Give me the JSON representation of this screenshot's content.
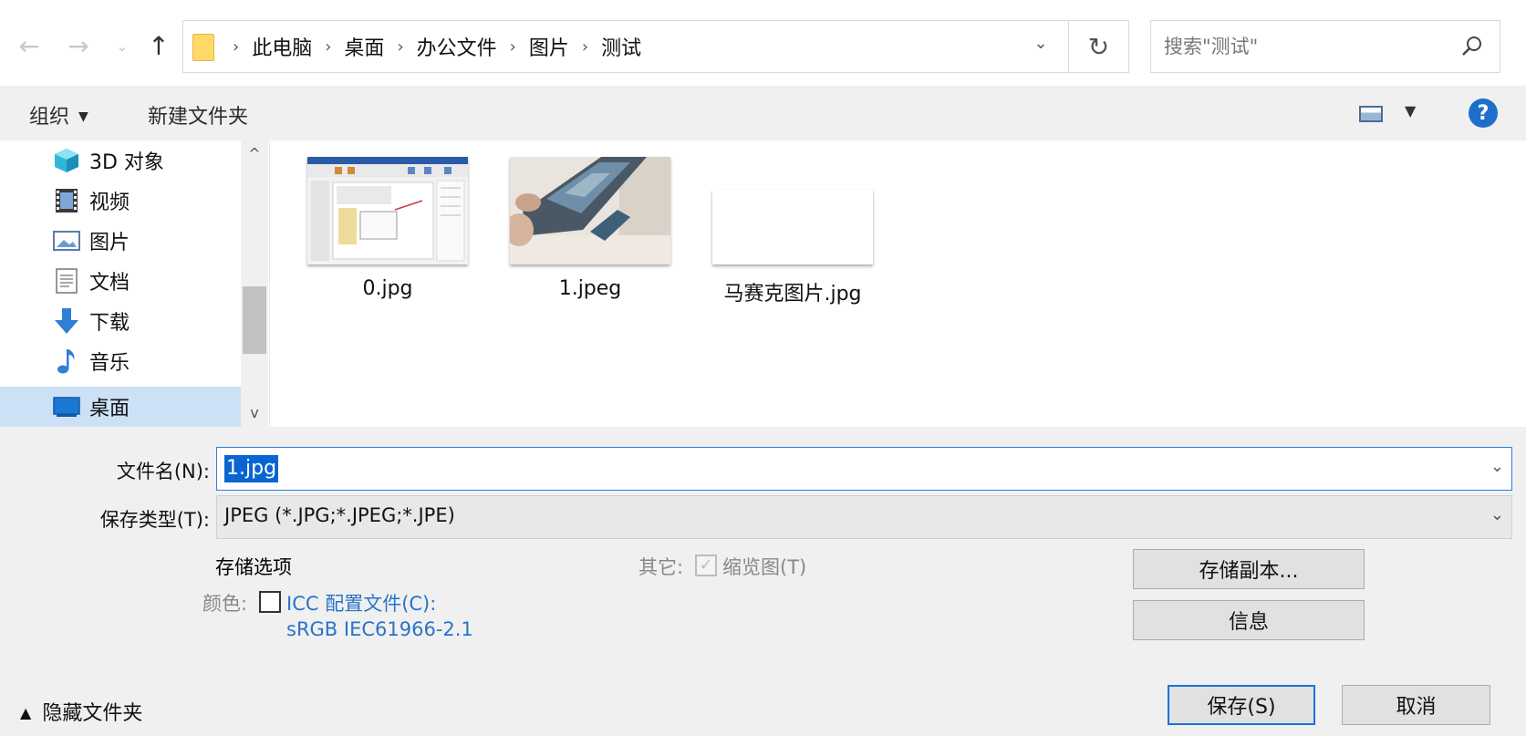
{
  "address": {
    "crumbs": [
      "此电脑",
      "桌面",
      "办公文件",
      "图片",
      "测试"
    ]
  },
  "search": {
    "placeholder": "搜索\"测试\""
  },
  "toolbar": {
    "organize_label": "组织",
    "new_folder_label": "新建文件夹",
    "help_label": "?"
  },
  "nav": {
    "items": [
      {
        "label": "3D 对象",
        "icon": "3d-objects-icon"
      },
      {
        "label": "视频",
        "icon": "video-icon"
      },
      {
        "label": "图片",
        "icon": "pictures-icon"
      },
      {
        "label": "文档",
        "icon": "documents-icon"
      },
      {
        "label": "下载",
        "icon": "download-icon"
      },
      {
        "label": "音乐",
        "icon": "music-icon"
      },
      {
        "label": "桌面",
        "icon": "desktop-icon",
        "selected": true
      }
    ]
  },
  "files": [
    {
      "name": "0.jpg"
    },
    {
      "name": "1.jpeg"
    },
    {
      "name": "马赛克图片.jpg"
    }
  ],
  "form": {
    "filename_label": "文件名(N):",
    "filename_value": "1.jpg",
    "filetype_label": "保存类型(T):",
    "filetype_value": "JPEG (*.JPG;*.JPEG;*.JPE)"
  },
  "options": {
    "save_options_label": "存储选项",
    "color_label": "颜色:",
    "icc_label": "ICC 配置文件(C):",
    "icc_profile": "sRGB IEC61966-2.1",
    "other_label": "其它:",
    "thumbnail_label": "缩览图(T)",
    "thumbnail_checked": true,
    "icc_checked": false
  },
  "buttons": {
    "save_copy": "存储副本...",
    "info": "信息",
    "save": "保存(S)",
    "cancel": "取消",
    "hide_folders": "隐藏文件夹"
  },
  "colors": {
    "accent": "#1a73d9",
    "link": "#2874c9",
    "selected": "#0a64d2"
  }
}
